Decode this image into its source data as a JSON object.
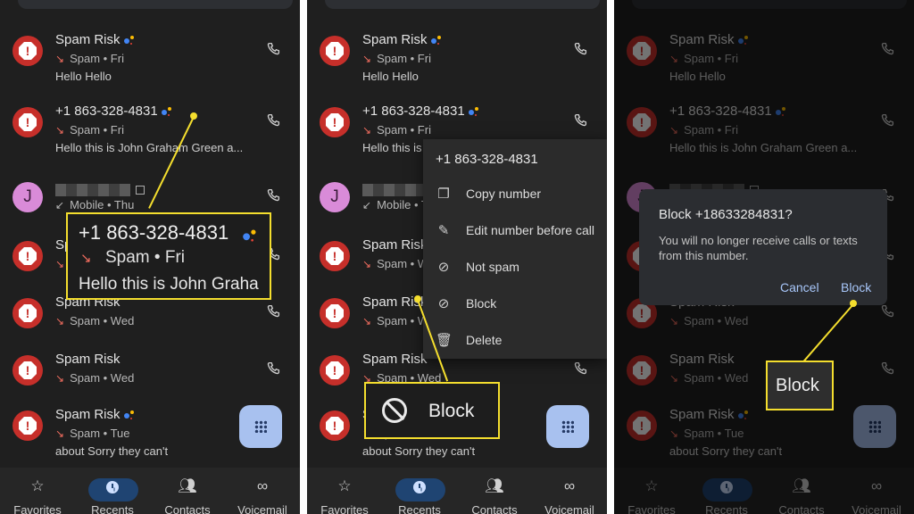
{
  "panels": [
    {
      "rows": [
        {
          "name": "Spam Risk",
          "verified": true,
          "sub": "Spam • Fri",
          "msg": "Hello  Hello"
        },
        {
          "name": "+1 863-328-4831",
          "verified": true,
          "sub": "Spam • Fri",
          "msg": "Hello this is John Graham Green a..."
        },
        {
          "name": "",
          "avatar_letter": "J",
          "sub": "Mobile • Thu",
          "msg": ""
        },
        {
          "name": "Spam Risk",
          "verified": false,
          "sub": "Spam • Wed",
          "msg": ""
        },
        {
          "name": "Spam Risk",
          "verified": false,
          "sub": "Spam • Wed",
          "msg": ""
        },
        {
          "name": "Spam Risk",
          "verified": false,
          "sub": "Spam • Wed",
          "msg": ""
        },
        {
          "name": "Spam Risk",
          "verified": true,
          "sub": "Spam • Tue",
          "msg": "about Sorry they can't"
        }
      ]
    }
  ],
  "nav": {
    "favorites": "Favorites",
    "recents": "Recents",
    "contacts": "Contacts",
    "voicemail": "Voicemail"
  },
  "callout1": {
    "number": "+1 863-328-4831",
    "sub": "Spam • Fri",
    "msg": "Hello this is John Graha"
  },
  "menu": {
    "title": "+1 863-328-4831",
    "items": [
      "Copy number",
      "Edit number before call",
      "Not spam",
      "Block",
      "Delete"
    ]
  },
  "callout2": {
    "label": "Block"
  },
  "dialog": {
    "title": "Block +18633284831?",
    "body": "You will no longer receive calls or texts from this number.",
    "cancel": "Cancel",
    "block": "Block"
  },
  "callout3": {
    "label": "Block"
  },
  "colors": {
    "accent_yellow": "#f4de2e",
    "spam_red": "#c62f2a",
    "dialog_button": "#a8c7fa"
  }
}
